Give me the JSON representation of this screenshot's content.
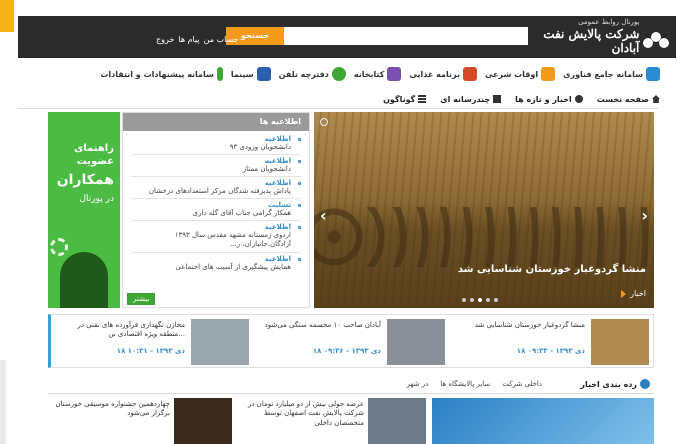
{
  "header": {
    "logo_top": "پورتال روابط عمومی",
    "logo_main": "شرکت پالایش نفت آبادان",
    "search_button": "جستجو",
    "search_placeholder": "",
    "account_link": "حساب من",
    "messages_link": "پیام ها",
    "logout_link": "خروج"
  },
  "iconbar": [
    {
      "label": "سامانه جامع فناوری",
      "color": "#2b8bd1"
    },
    {
      "label": "اوقات شرعی",
      "color": "#f39a1a"
    },
    {
      "label": "برنامه غذایی",
      "color": "#d64a2b"
    },
    {
      "label": "کتابخانه",
      "color": "#7a4fb0"
    },
    {
      "label": "دفترچه تلفن",
      "color": "#3fa535"
    },
    {
      "label": "سینما",
      "color": "#2b5fb0"
    },
    {
      "label": "سامانه پیشنهادات و انتقادات",
      "color": "#3fa535"
    }
  ],
  "nav": [
    {
      "label": "صفحه نخست",
      "icon": "home-icon"
    },
    {
      "label": "اخبار و تازه ها",
      "icon": "globe-icon"
    },
    {
      "label": "چندرسانه ای",
      "icon": "media-icon"
    },
    {
      "label": "گوناگون",
      "icon": "list-icon"
    }
  ],
  "slider": {
    "caption": "منشا گردوغبار خوزستان شناسایی شد",
    "link": "اخبار"
  },
  "announcements": {
    "title": "اطلاعیه ها",
    "items": [
      {
        "tag": "اطلاعیه",
        "text": "دانشجویان ورودی ۹۳"
      },
      {
        "tag": "اطلاعیه",
        "text": "دانشجویان ممتاز"
      },
      {
        "tag": "اطلاعیه",
        "text": "پاداش پذیرفته شدگان مرکز استعدادهای درخشان"
      },
      {
        "tag": "تسلیت",
        "text": "همکار گرامی جناب آقای گله داری"
      },
      {
        "tag": "اطلاعیه",
        "text": "اردوی زمستانه مشهد مقدس سال ۱۳۹۳ آزادگان،جانبازان، ر..."
      },
      {
        "tag": "اطلاعیه",
        "text": "همایش پیشگیری از آسیب های اجتماعی"
      }
    ],
    "more": "بیشتر"
  },
  "member_banner": {
    "line1": "راهنمای",
    "line2": "عضویت",
    "big": "همکاران",
    "portal": "در پورتال"
  },
  "news_strip": [
    {
      "title": "منشا گردوغبار خوزستان شناسایی شد",
      "date": "۱۸ دی ۱۳۹۳ - ۰۹:۳۳",
      "thumb_color": "#b08b4f"
    },
    {
      "title": "آبادان صاحب ۱۰ مجسمه سنگی می‌شود",
      "date": "۱۸ دی ۱۳۹۳ - ۰۹:۳۶",
      "thumb_color": "#8a8f98"
    },
    {
      "title": "مخازن نگهداری فرآورده های نفتی در منطقه ویژه اقتصادی بن...",
      "date": "۱۸ دی ۱۳۹۳ - ۱۰:۳۱",
      "thumb_color": "#9aa7ae"
    }
  ],
  "categories": {
    "title": "رده بندی اخبار",
    "tabs": [
      "داخلی شرکت",
      "سایر پالایشگاه ها",
      "در شهر"
    ]
  },
  "bottom_news": [
    {
      "text": "",
      "thumb_color": "#2a7fc4"
    },
    {
      "text": "عرضه جولی بیش از دو میلیارد تومان در شرکت پالایش نفت اصفهان توسط متخصصان داخلی",
      "thumb_color": "#6d7a88"
    },
    {
      "text": "چهاردهمین جشنواره موسیقی خوزستان برگزار می‌شود",
      "thumb_color": "#3a2a1e"
    }
  ]
}
